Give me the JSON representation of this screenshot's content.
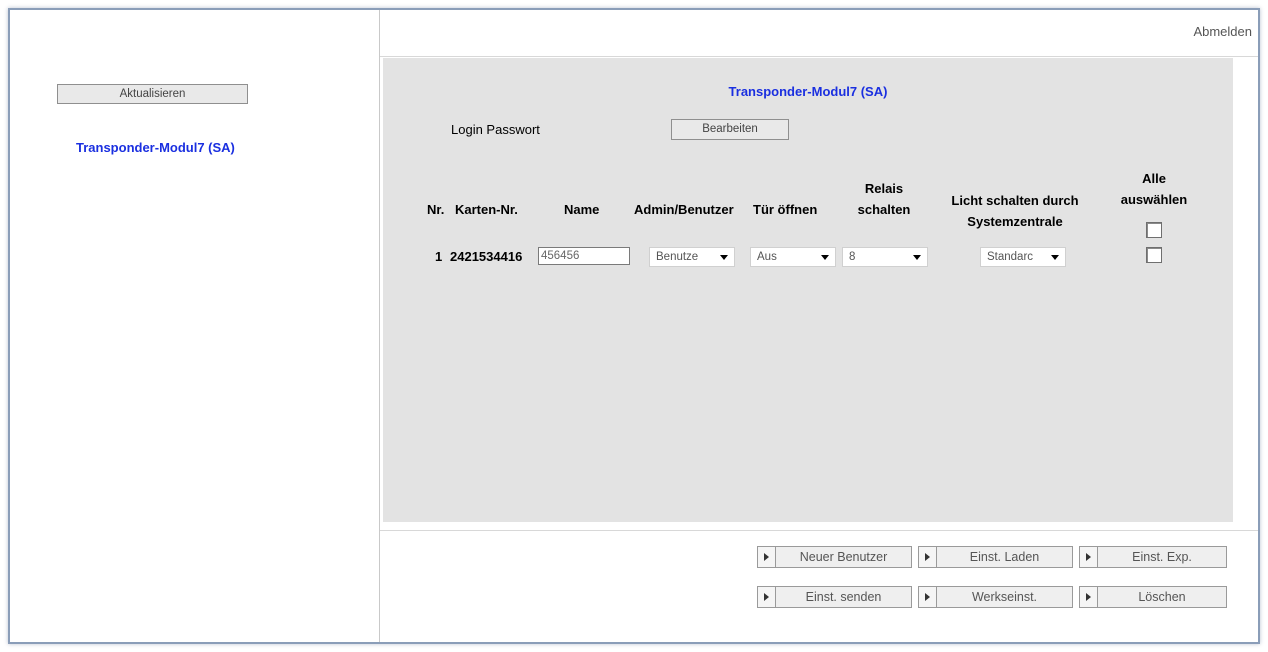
{
  "sidebar": {
    "refresh_label": "Aktualisieren",
    "module_title": "Transponder-Modul7 (SA)"
  },
  "header": {
    "logout_label": "Abmelden"
  },
  "panel": {
    "title": "Transponder-Modul7 (SA)",
    "login_password_label": "Login Passwort",
    "edit_label": "Bearbeiten",
    "columns": {
      "nr": "Nr.",
      "card": "Karten-Nr.",
      "name": "Name",
      "role": "Admin/Benutzer",
      "door": "Tür öffnen",
      "relay_line1": "Relais",
      "relay_line2": "schalten",
      "light_line1": "Licht schalten durch",
      "light_line2": "Systemzentrale",
      "all_line1": "Alle",
      "all_line2": "auswählen"
    },
    "rows": [
      {
        "nr": "1",
        "card": "2421534416",
        "name": "456456",
        "role": "Benutze",
        "door": "Aus",
        "relay": "8",
        "light": "Standarc"
      }
    ]
  },
  "actions": {
    "new_user": "Neuer Benutzer",
    "load_settings": "Einst. Laden",
    "export_settings": "Einst. Exp.",
    "send_settings": "Einst. senden",
    "factory_settings": "Werkseinst.",
    "delete": "Löschen"
  },
  "colors": {
    "accent_title": "#1a2fe0",
    "panel_bg": "#e3e3e3",
    "frame_border": "#8a9db8"
  }
}
